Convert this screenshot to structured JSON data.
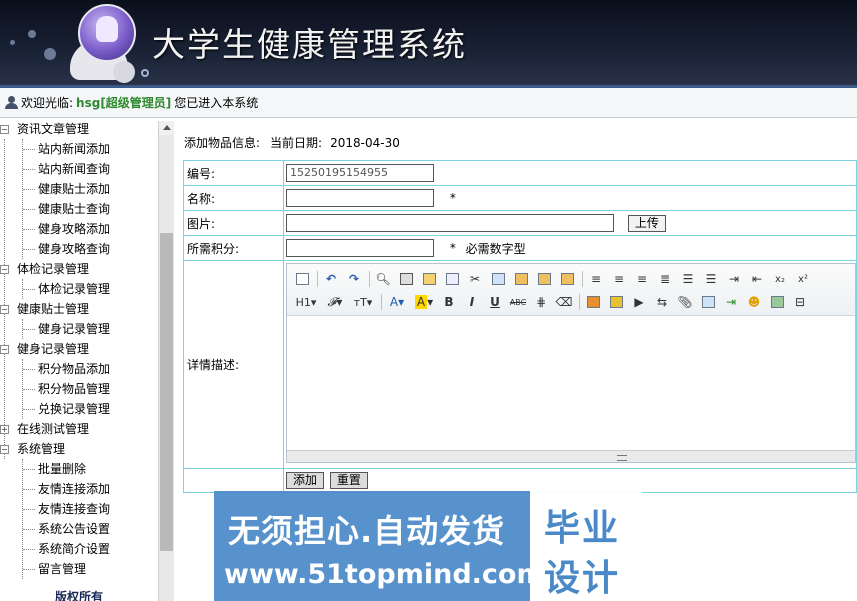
{
  "header": {
    "title": "大学生健康管理系统"
  },
  "welcome": {
    "prefix": "欢迎光临:",
    "user": "hsg[超级管理员]",
    "suffix": "您已进入本系统"
  },
  "sidebar": {
    "groups": [
      {
        "label": "资讯文章管理",
        "items": [
          "站内新闻添加",
          "站内新闻查询",
          "健康贴士添加",
          "健康贴士查询",
          "健身攻略添加",
          "健身攻略查询"
        ]
      },
      {
        "label": "体检记录管理",
        "items": [
          "体检记录管理"
        ]
      },
      {
        "label": "健康贴士管理",
        "items": [
          "健身记录管理"
        ]
      },
      {
        "label": "健身记录管理",
        "items": [
          "积分物品添加",
          "积分物品管理",
          "兑换记录管理"
        ]
      },
      {
        "label": "在线测试管理",
        "items": []
      },
      {
        "label": "系统管理",
        "items": [
          "批量删除",
          "友情连接添加",
          "友情连接查询",
          "系统公告设置",
          "系统简介设置",
          "留言管理"
        ]
      }
    ],
    "copyright": "版权所有"
  },
  "form": {
    "heading": "添加物品信息:",
    "date_label": "当前日期:",
    "date_value": "2018-04-30",
    "fields": {
      "code": {
        "label": "编号:",
        "value": "15250195154955"
      },
      "name": {
        "label": "名称:",
        "required": "*"
      },
      "image": {
        "label": "图片:",
        "upload": "上传"
      },
      "points": {
        "label": "所需积分:",
        "required": "*",
        "hint": "必需数字型"
      },
      "detail": {
        "label": "详情描述:"
      }
    },
    "buttons": {
      "add": "添加",
      "reset": "重置"
    }
  },
  "watermark": {
    "line1": "无须担心.自动发货",
    "line2": "www.51topmind.com",
    "side1": "毕业",
    "side2": "设计"
  },
  "colors": {
    "border": "#7ad3e0",
    "username": "#2f8a2f",
    "watermark": "#4a89c8"
  }
}
